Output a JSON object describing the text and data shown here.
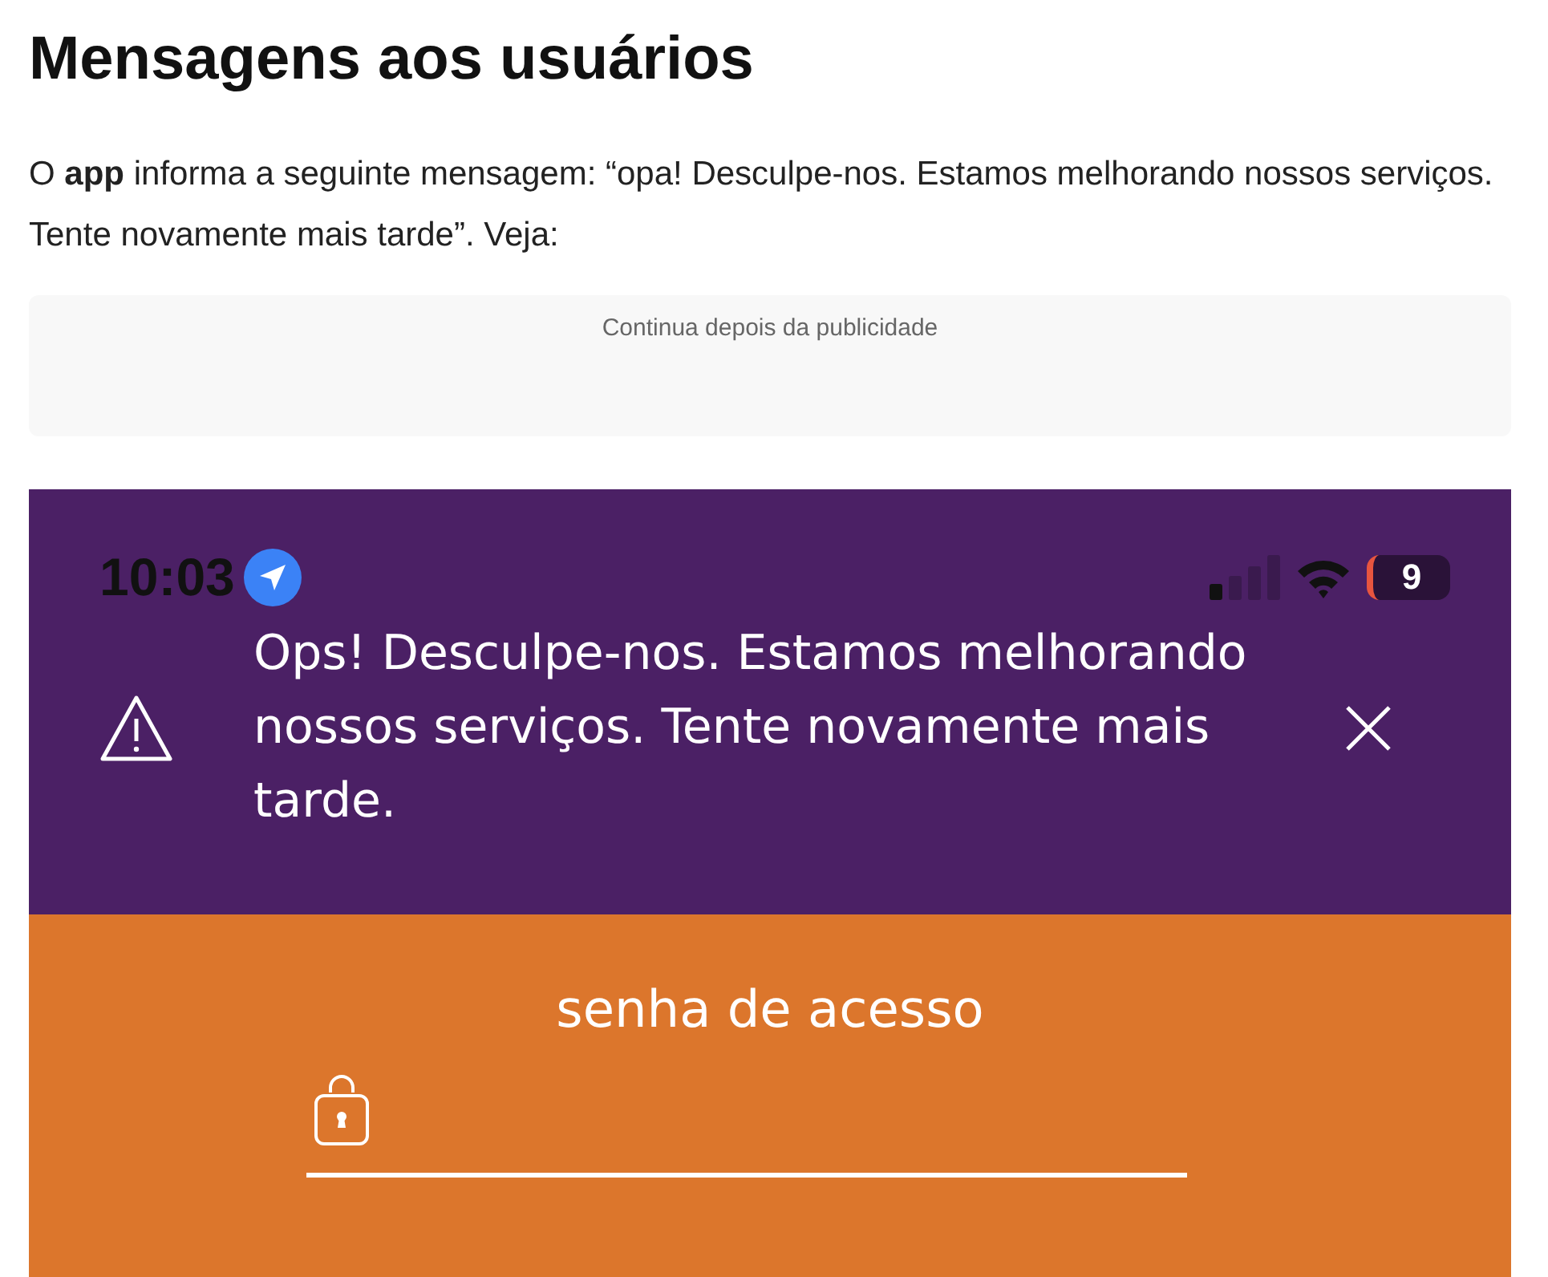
{
  "article": {
    "heading": "Mensagens aos usuários",
    "paragraph": "O **app** informa a seguinte mensagem: “opa! Desculpe-nos. Estamos melhorando nossos serviços. Tente novamente mais tarde”. Veja:",
    "ad_notice": "Continua depois da publicidade"
  },
  "phone": {
    "status_bar": {
      "time": "10:03",
      "battery": "9"
    },
    "alert": {
      "message": "Ops! Desculpe-nos. Estamos melhorando nossos serviços. Tente novamente mais tarde."
    },
    "login": {
      "label": "senha de acesso"
    }
  }
}
